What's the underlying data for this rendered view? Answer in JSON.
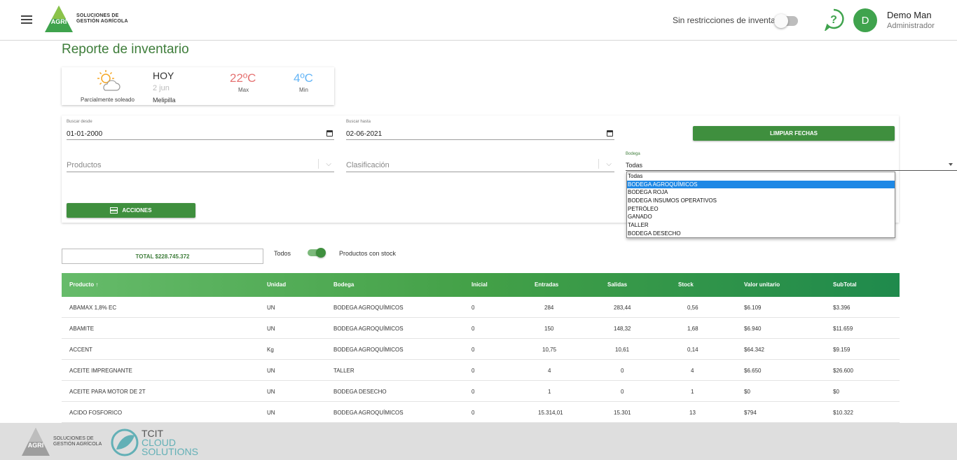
{
  "header": {
    "brand_text_1": "SOLUCIONES DE",
    "brand_text_2": "GESTIÓN AGRÍCOLA",
    "logo_mark": "AGRI",
    "inventory_toggle_label": "Sin restricciones de inventario",
    "user": {
      "initial": "D",
      "name": "Demo Man",
      "role": "Administrador"
    }
  },
  "page": {
    "title": "Reporte de inventario"
  },
  "weather": {
    "condition": "Parcialmente soleado",
    "day": "HOY",
    "date": "2 jun",
    "location": "Melipilla",
    "max": "22ºC",
    "max_label": "Max",
    "min": "4ºC",
    "min_label": "Min"
  },
  "filters": {
    "from_label": "Buscar desde",
    "from_value": "01-01-2000",
    "to_label": "Buscar hasta",
    "to_value": "02-06-2021",
    "clear_dates": "LIMPIAR FECHAS",
    "products_placeholder": "Productos",
    "classification_placeholder": "Clasificación",
    "bodega_label": "Bodega",
    "bodega_value": "Todas",
    "bodega_options": [
      "Todas",
      "BODEGA AGROQUÍMICOS",
      "BODEGA ROJA",
      "BODEGA INSUMOS OPERATIVOS",
      "PETRÓLEO",
      "GANADO",
      "TALLER",
      "BODEGA DESECHO"
    ],
    "bodega_highlight": "BODEGA AGROQUÍMICOS",
    "actions": "ACCIONES"
  },
  "summary": {
    "total": "TOTAL $228.745.372",
    "all_label": "Todos",
    "stock_label": "Productos con stock"
  },
  "table": {
    "columns": [
      "Producto",
      "Unidad",
      "Bodega",
      "Inicial",
      "Entradas",
      "Salidas",
      "Stock",
      "Valor unitario",
      "SubTotal"
    ],
    "rows": [
      [
        "ABAMAX 1,8% EC",
        "UN",
        "BODEGA AGROQUÍMICOS",
        "0",
        "284",
        "283,44",
        "0,56",
        "$6.109",
        "$3.396"
      ],
      [
        "ABAMITE",
        "UN",
        "BODEGA AGROQUÍMICOS",
        "0",
        "150",
        "148,32",
        "1,68",
        "$6.940",
        "$11.659"
      ],
      [
        "ACCENT",
        "Kg",
        "BODEGA AGROQUÍMICOS",
        "0",
        "10,75",
        "10,61",
        "0,14",
        "$64.342",
        "$9.159"
      ],
      [
        "ACEITE IMPREGNANTE",
        "UN",
        "TALLER",
        "0",
        "4",
        "0",
        "4",
        "$6.650",
        "$26.600"
      ],
      [
        "ACEITE PARA MOTOR DE 2T",
        "UN",
        "BODEGA DESECHO",
        "0",
        "1",
        "0",
        "1",
        "$0",
        "$0"
      ],
      [
        "ACIDO FOSFORICO",
        "UN",
        "BODEGA AGROQUÍMICOS",
        "0",
        "15.314,01",
        "15.301",
        "13",
        "$794",
        "$10.322"
      ]
    ]
  },
  "footer": {
    "brand_text_1": "SOLUCIONES DE",
    "brand_text_2": "GESTIÓN AGRÍCOLA",
    "tcit_1": "TCIT",
    "tcit_2": "CLOUD",
    "tcit_3": "SOLUTIONS"
  },
  "colors": {
    "primary_green": "#3f8f3e",
    "title_green": "#3e7d3a",
    "max_temp": "#e57373",
    "min_temp": "#64b5f6",
    "selected_option": "#1e88e5"
  }
}
